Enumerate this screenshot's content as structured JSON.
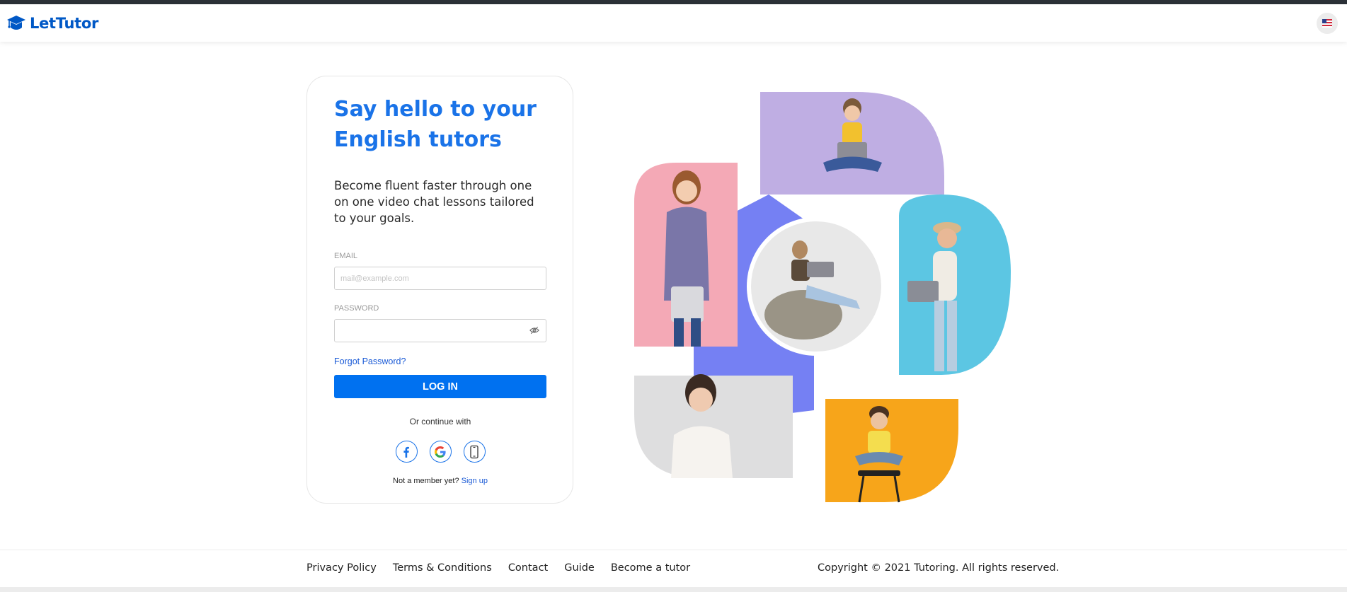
{
  "header": {
    "brand_name": "LetTutor",
    "logo_icon": "graduation-cap-icon",
    "language_icon": "us-flag-icon"
  },
  "login": {
    "title": "Say hello to your English tutors",
    "description": "Become fluent faster through one on one video chat lessons tailored to your goals.",
    "email_label": "EMAIL",
    "email_placeholder": "mail@example.com",
    "email_value": "",
    "password_label": "PASSWORD",
    "password_value": "",
    "password_toggle_icon": "eye-slash-icon",
    "forgot_password": "Forgot Password?",
    "login_button": "LOG IN",
    "or_continue": "Or continue with",
    "social_icons": [
      "facebook-icon",
      "google-icon",
      "phone-icon"
    ],
    "not_member": "Not a member yet?",
    "sign_up": "Sign up"
  },
  "colors": {
    "brand_blue": "#0058c6",
    "title_blue": "#1a73e8",
    "button_blue": "#0071f0",
    "hexagon": "#7580f3",
    "purple_tile": "#bfaee3",
    "pink_tile": "#f4a9b6",
    "cyan_tile": "#5cc6e3",
    "orange_tile": "#f7a51a"
  },
  "footer": {
    "links": [
      "Privacy Policy",
      "Terms & Conditions",
      "Contact",
      "Guide",
      "Become a tutor"
    ],
    "copyright": "Copyright © 2021 Tutoring. All rights reserved."
  }
}
